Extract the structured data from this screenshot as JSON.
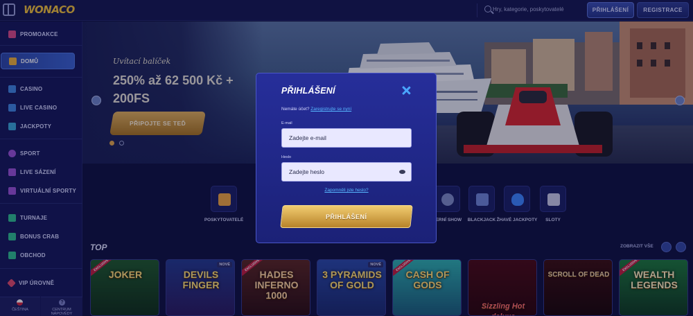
{
  "brand": {
    "logo_text": "WONACO",
    "accent": "#f2c23a"
  },
  "header": {
    "search_placeholder": "Hry, kategorie, poskytovatelé",
    "login_label": "PŘIHLÁŠENÍ",
    "register_label": "REGISTRACE"
  },
  "sidebar": {
    "items": [
      {
        "label": "PROMOAKCE",
        "icon": "gift-icon"
      },
      {
        "label": "DOMŮ",
        "icon": "home-icon"
      },
      {
        "label": "CASINO",
        "icon": "casino-icon"
      },
      {
        "label": "LIVE CASINO",
        "icon": "live-casino-icon"
      },
      {
        "label": "JACKPOTY",
        "icon": "jackpot-icon"
      },
      {
        "label": "SPORT",
        "icon": "sport-icon"
      },
      {
        "label": "LIVE SÁZENÍ",
        "icon": "live-betting-icon"
      },
      {
        "label": "VIRTUÁLNÍ SPORTY",
        "icon": "virtual-sports-icon"
      },
      {
        "label": "TURNAJE",
        "icon": "trophy-icon"
      },
      {
        "label": "BONUS CRAB",
        "icon": "crab-icon"
      },
      {
        "label": "OBCHOD",
        "icon": "shop-icon"
      },
      {
        "label": "VIP ÚROVNĚ",
        "icon": "vip-icon"
      }
    ],
    "footer": {
      "language_label": "ČEŠTINA",
      "help_label_1": "CENTRUM",
      "help_label_2": "NÁPOVĚDY"
    }
  },
  "banner": {
    "subtitle": "Uvítací balíček",
    "headline": "250% až 62 500 Kč + 200FS",
    "cta_label": "PŘIPOJTE SE TEĎ"
  },
  "categories": [
    {
      "label": "POSKYTOVATELÉ",
      "icon": "providers-icon"
    },
    {
      "label": "HERNÍ SHOW",
      "icon": "game-show-icon"
    },
    {
      "label": "BLACKJACK",
      "icon": "blackjack-icon"
    },
    {
      "label": "ŽHAVÉ JACKPOTY",
      "icon": "hot-jackpot-icon"
    },
    {
      "label": "SLOTY",
      "icon": "slots-icon"
    }
  ],
  "top_section": {
    "title": "TOP",
    "show_all_label": "ZOBRAZIT VŠE",
    "games": [
      {
        "title": "JOKER",
        "badge": "EXCLUSIVE"
      },
      {
        "title": "DEVILS FINGER",
        "badge": "NOVÉ"
      },
      {
        "title": "HADES INFERNO 1000",
        "badge": "EXCLUSIVE"
      },
      {
        "title": "3 PYRAMIDS OF GOLD",
        "badge": "NOVÉ"
      },
      {
        "title": "CASH OF GODS",
        "badge": "EXCLUSIVE"
      },
      {
        "title": "Sizzling Hot deluxe",
        "badge": ""
      },
      {
        "title": "SCROLL OF DEAD",
        "badge": ""
      },
      {
        "title": "WEALTH LEGENDS",
        "badge": "EXCLUSIVE"
      }
    ]
  },
  "login_modal": {
    "title": "PŘIHLÁŠENÍ",
    "no_account_text": "Nemáte účet?",
    "register_link": "Zaregistrujte se nyní",
    "email_label": "E-mail",
    "email_placeholder": "Zadejte e-mail",
    "password_label": "Heslo",
    "password_placeholder": "Zadejte heslo",
    "forgot_link": "Zapomněli jste heslo?",
    "submit_label": "PŘIHLÁŠENÍ"
  }
}
